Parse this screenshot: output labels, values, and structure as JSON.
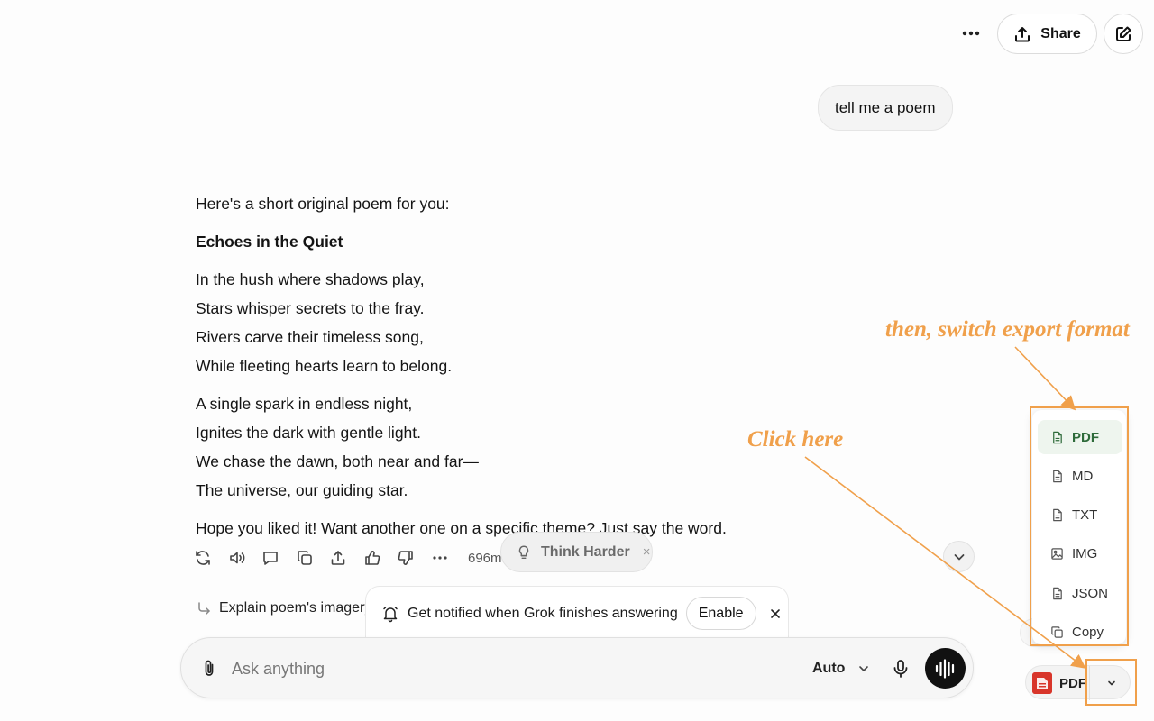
{
  "header": {
    "share_label": "Share"
  },
  "user_message": "tell me a poem",
  "answer": {
    "intro": "Here's a short original poem for you:",
    "title": "Echoes in the Quiet",
    "stanza1": [
      "In the hush where shadows play,",
      "Stars whisper secrets to the fray.",
      "Rivers carve their timeless song,",
      "While fleeting hearts learn to belong."
    ],
    "stanza2": [
      "A single spark in endless night,",
      "Ignites the dark with gentle light.",
      "We chase the dawn, both near and far—",
      "The universe, our guiding star."
    ],
    "outro": "Hope you liked it! Want another one on a specific theme? Just say the word."
  },
  "actions": {
    "timing": "696ms"
  },
  "think_harder": {
    "label": "Think Harder",
    "close": "×"
  },
  "suggestion": {
    "label": "Explain poem's imagery"
  },
  "notification": {
    "text": "Get notified when Grok finishes answering",
    "enable_label": "Enable"
  },
  "composer": {
    "placeholder": "Ask anything",
    "mode_label": "Auto"
  },
  "export_menu": {
    "items": [
      {
        "label": "PDF",
        "icon": "file-icon",
        "active": true
      },
      {
        "label": "MD",
        "icon": "file-icon",
        "active": false
      },
      {
        "label": "TXT",
        "icon": "file-icon",
        "active": false
      },
      {
        "label": "IMG",
        "icon": "image-icon",
        "active": false
      },
      {
        "label": "JSON",
        "icon": "file-icon",
        "active": false
      },
      {
        "label": "Copy",
        "icon": "copy-icon",
        "active": false
      }
    ],
    "button_label": "PDF"
  },
  "annotations": {
    "switch_format": "then, switch export format",
    "click_here": "Click here",
    "color": "#f0a04b"
  },
  "colors": {
    "active_item_bg": "#eef5ee",
    "active_item_text": "#2e6b3a",
    "pdf_red": "#d8352a"
  }
}
